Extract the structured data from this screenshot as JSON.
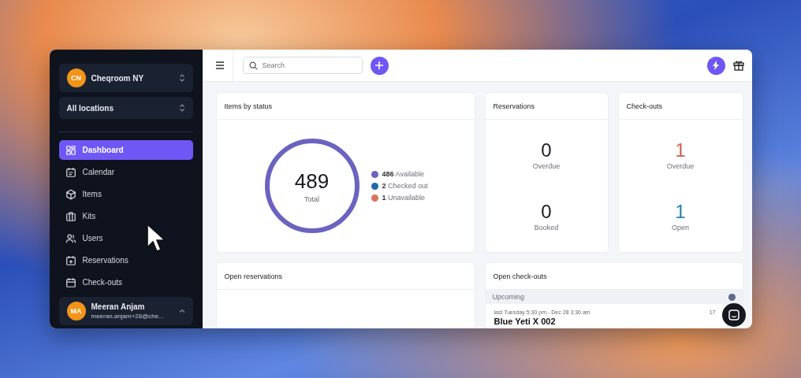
{
  "sidebar": {
    "organization": {
      "initials": "CN",
      "name": "Cheqroom NY"
    },
    "location": {
      "label": "All locations"
    },
    "items": [
      {
        "label": "Dashboard",
        "selected": true
      },
      {
        "label": "Calendar",
        "selected": false
      },
      {
        "label": "Items",
        "selected": false
      },
      {
        "label": "Kits",
        "selected": false
      },
      {
        "label": "Users",
        "selected": false
      },
      {
        "label": "Reservations",
        "selected": false
      },
      {
        "label": "Check-outs",
        "selected": false
      }
    ],
    "user": {
      "initials": "MA",
      "name": "Meeran Anjam",
      "email": "meeran.anjam+28@che..."
    }
  },
  "topbar": {
    "search": {
      "placeholder": "Search"
    }
  },
  "items_by_status": {
    "title": "Items by status",
    "total": "489",
    "total_label": "Total",
    "legend": [
      {
        "text": "**486** Available",
        "color": "#6a63c0"
      },
      {
        "text": "**2** Checked out",
        "color": "#1f6aa8"
      },
      {
        "text": "**1** Unavailable",
        "color": "#d9735e"
      }
    ]
  },
  "reservations": {
    "title": "Reservations",
    "stats": [
      {
        "value": "0",
        "label": "Overdue",
        "color": "#1b1d23"
      },
      {
        "value": "0",
        "label": "Booked",
        "color": "#1b1d23"
      }
    ]
  },
  "checkouts": {
    "title": "Check-outs",
    "stats": [
      {
        "value": "1",
        "label": "Overdue",
        "color": "#c9604a"
      },
      {
        "value": "1",
        "label": "Open",
        "color": "#2b7fb0"
      }
    ]
  },
  "open_reservations": {
    "title": "Open reservations"
  },
  "open_checkouts": {
    "title": "Open check-outs",
    "section": "Upcoming",
    "rows": [
      {
        "period": "last Tuesday 5:30 pm - Dec 28 3:30 am",
        "name": "Blue Yeti X 002",
        "column_3": "17"
      }
    ]
  }
}
